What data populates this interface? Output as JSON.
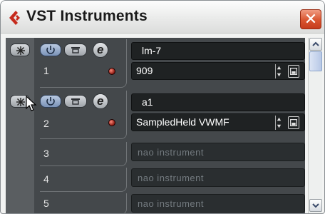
{
  "window": {
    "title": "VST Instruments",
    "close_icon": "close-icon"
  },
  "slots": [
    {
      "number": "1",
      "instrument_name": "lm-7",
      "preset": "909",
      "active": true
    },
    {
      "number": "2",
      "instrument_name": "a1",
      "preset": "SampledHeld VWMF",
      "active": true
    },
    {
      "number": "3",
      "empty_label": "nao instrument"
    },
    {
      "number": "4",
      "empty_label": "nao instrument"
    },
    {
      "number": "5",
      "empty_label": "nao instrument"
    }
  ],
  "icons": {
    "freeze": "snowflake-icon",
    "power": "power-icon",
    "edit": "edit-icon",
    "up_down": "up-down-arrows-icon",
    "save": "save-icon",
    "scroll_up": "chevron-up-icon",
    "scroll_down": "chevron-down-icon"
  },
  "colors": {
    "panel": "#44484b",
    "led": "#b4291d",
    "close_button": "#d9542f"
  }
}
